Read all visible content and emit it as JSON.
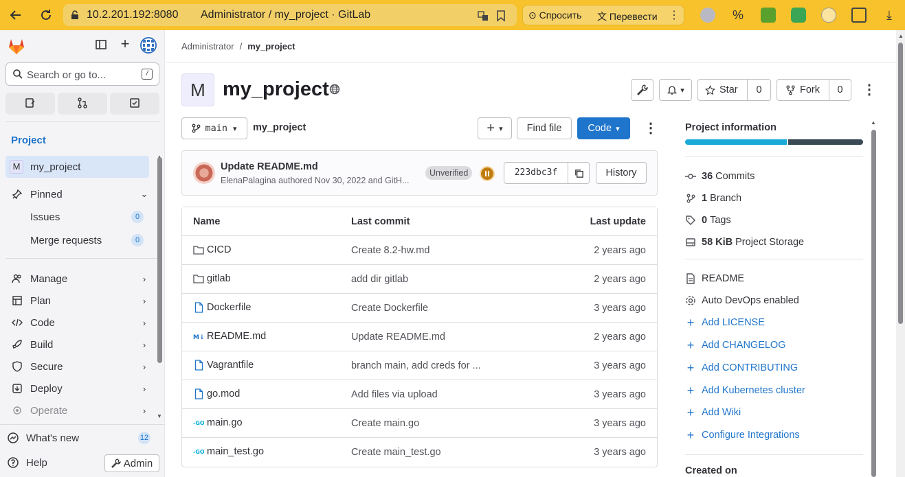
{
  "browser": {
    "url": "10.2.201.192:8080",
    "tab_title": "Administrator / my_project · GitLab",
    "ask_label": "Спросить",
    "translate_label": "Перевести"
  },
  "sidebar": {
    "search_placeholder": "Search or go to...",
    "search_shortcut": "/",
    "section_title": "Project",
    "project_avatar_letter": "M",
    "project_name": "my_project",
    "pinned_label": "Pinned",
    "pinned_items": [
      {
        "label": "Issues",
        "count": "0"
      },
      {
        "label": "Merge requests",
        "count": "0"
      }
    ],
    "nav_items": [
      {
        "label": "Manage"
      },
      {
        "label": "Plan"
      },
      {
        "label": "Code"
      },
      {
        "label": "Build"
      },
      {
        "label": "Secure"
      },
      {
        "label": "Deploy"
      },
      {
        "label": "Operate"
      }
    ],
    "whats_new_label": "What's new",
    "whats_new_count": "12",
    "help_label": "Help",
    "admin_label": "Admin"
  },
  "breadcrumb": {
    "parent": "Administrator",
    "sep": "/",
    "current": "my_project"
  },
  "project": {
    "avatar_letter": "M",
    "title": "my_project",
    "star_label": "Star",
    "star_count": "0",
    "fork_label": "Fork",
    "fork_count": "0"
  },
  "repo_toolbar": {
    "branch": "main",
    "path": "my_project",
    "find_file_label": "Find file",
    "code_label": "Code"
  },
  "last_commit": {
    "title": "Update README.md",
    "author_line": "ElenaPalagina authored Nov 30, 2022 and GitH...",
    "unverified_label": "Unverified",
    "sha": "223dbc3f",
    "history_label": "History"
  },
  "file_table": {
    "headers": {
      "name": "Name",
      "last_commit": "Last commit",
      "last_update": "Last update"
    },
    "rows": [
      {
        "name": "CICD",
        "type": "folder",
        "commit": "Create 8.2-hw.md",
        "updated": "2 years ago"
      },
      {
        "name": "gitlab",
        "type": "folder",
        "commit": "add dir gitlab",
        "updated": "2 years ago"
      },
      {
        "name": "Dockerfile",
        "type": "file",
        "commit": "Create Dockerfile",
        "updated": "3 years ago"
      },
      {
        "name": "README.md",
        "type": "markdown",
        "commit": "Update README.md",
        "updated": "2 years ago"
      },
      {
        "name": "Vagrantfile",
        "type": "file",
        "commit": "branch main, add creds for ...",
        "updated": "3 years ago"
      },
      {
        "name": "go.mod",
        "type": "file",
        "commit": "Add files via upload",
        "updated": "3 years ago"
      },
      {
        "name": "main.go",
        "type": "go",
        "commit": "Create main.go",
        "updated": "3 years ago"
      },
      {
        "name": "main_test.go",
        "type": "go",
        "commit": "Create main_test.go",
        "updated": "3 years ago"
      }
    ]
  },
  "project_info": {
    "title": "Project information",
    "language_bar_fraction": 0.57,
    "commits_count": "36",
    "commits_label": "Commits",
    "branch_count": "1",
    "branch_label": "Branch",
    "tags_count": "0",
    "tags_label": "Tags",
    "storage_size": "58 KiB",
    "storage_label": "Project Storage",
    "readme_label": "README",
    "autodevops_label": "Auto DevOps enabled",
    "links": [
      "Add LICENSE",
      "Add CHANGELOG",
      "Add CONTRIBUTING",
      "Add Kubernetes cluster",
      "Add Wiki",
      "Configure Integrations"
    ],
    "created_on_label": "Created on"
  },
  "colors": {
    "browser_bar": "#f7c22b",
    "accent": "#1f75cb",
    "language_primary": "#1aaad8",
    "language_secondary": "#3a4a55"
  }
}
